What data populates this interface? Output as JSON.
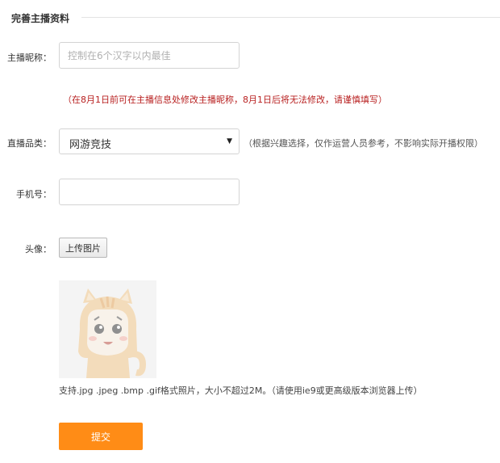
{
  "section": {
    "title": "完善主播资料"
  },
  "form": {
    "nickname": {
      "label": "主播昵称：",
      "placeholder": "控制在6个汉字以内最佳",
      "value": "",
      "note": "（在8月1日前可在主播信息处修改主播昵称，8月1日后将无法修改，请谨慎填写）"
    },
    "category": {
      "label": "直播品类：",
      "selected": "网游竞技",
      "note": "（根据兴趣选择，仅作运营人员参考，不影响实际开播权限）"
    },
    "phone": {
      "label": "手机号：",
      "value": "",
      "placeholder": ""
    },
    "avatar": {
      "label": "头像：",
      "upload_label": "上传图片",
      "note": "支持.jpg .jpeg .bmp .gif格式照片，大小不超过2M。（请使用ie9或更高级版本浏览器上传）"
    },
    "submit_label": "提交"
  },
  "colors": {
    "accent": "#ff8c16",
    "warning_text": "#b82020",
    "border": "#d4d4d4"
  },
  "icons": {
    "select_arrow": "▼"
  }
}
